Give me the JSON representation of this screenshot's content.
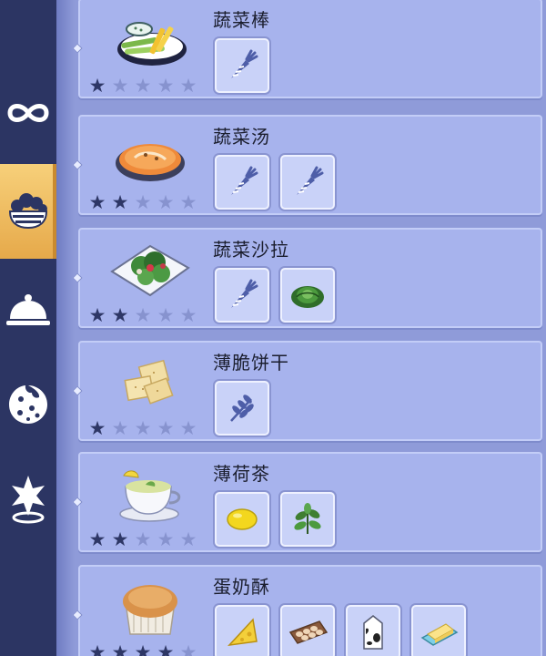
{
  "colors": {
    "background": "#8f9bd9",
    "sidebar": "#2c3563",
    "active_tab": "#e6a94a",
    "card": "#a7b3ed",
    "star_filled": "#2e3766",
    "star_empty": "#8793cf"
  },
  "sidebar": {
    "tabs": [
      {
        "icon": "infinity-icon",
        "active": false
      },
      {
        "icon": "salad-bowl-icon",
        "active": true
      },
      {
        "icon": "cloche-icon",
        "active": false
      },
      {
        "icon": "cookie-icon",
        "active": false
      },
      {
        "icon": "star-pin-icon",
        "active": false
      }
    ]
  },
  "recipes": [
    {
      "name": "蔬菜棒",
      "stars": 1,
      "max_stars": 5,
      "dish_icon": "veggie-sticks-icon",
      "ingredients": [
        "carrot-icon"
      ]
    },
    {
      "name": "蔬菜汤",
      "stars": 2,
      "max_stars": 5,
      "dish_icon": "vegetable-soup-icon",
      "ingredients": [
        "carrot-icon",
        "carrot-icon"
      ]
    },
    {
      "name": "蔬菜沙拉",
      "stars": 2,
      "max_stars": 5,
      "dish_icon": "salad-icon",
      "ingredients": [
        "carrot-icon",
        "cabbage-icon"
      ]
    },
    {
      "name": "薄脆饼干",
      "stars": 1,
      "max_stars": 5,
      "dish_icon": "crackers-icon",
      "ingredients": [
        "wheat-icon"
      ]
    },
    {
      "name": "薄荷茶",
      "stars": 2,
      "max_stars": 5,
      "dish_icon": "mint-tea-icon",
      "ingredients": [
        "lemon-icon",
        "mint-icon"
      ]
    },
    {
      "name": "蛋奶酥",
      "stars": 4,
      "max_stars": 5,
      "dish_icon": "souffle-icon",
      "ingredients": [
        "cheese-icon",
        "eggs-icon",
        "milk-icon",
        "butter-icon"
      ]
    }
  ]
}
